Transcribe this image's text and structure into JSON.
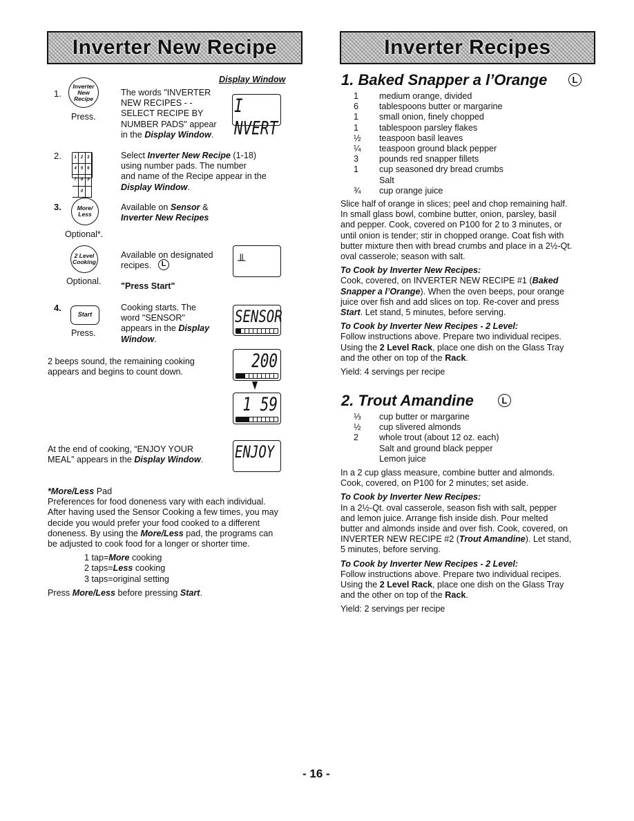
{
  "page_number": "- 16 -",
  "left": {
    "banner_title": "Inverter New Recipe",
    "display_window_heading": "Display Window",
    "steps": [
      {
        "number": "1.",
        "button_label_lines": [
          "Inverter",
          "New",
          "Recipe"
        ],
        "caption": "Press.",
        "text_lines": [
          "The words \"INVERTER",
          "NEW RECIPES - -",
          "SELECT RECIPE BY",
          "NUMBER PADS\" appear"
        ],
        "text_tail_prefix": "in the ",
        "text_tail_bold": "Display Window",
        "text_tail_suffix": ".",
        "display": "I NVERT"
      },
      {
        "number": "2.",
        "keypad_keys": [
          "1",
          "2",
          "3",
          "4",
          "5",
          "6",
          "7",
          "8",
          "9",
          "",
          "0",
          ""
        ],
        "text_prefix": "Select ",
        "text_bold": "Inverter New Recipe",
        "text_suffix": " (1-18)",
        "text_lines": [
          "using number pads. The number",
          "and name of the Recipe appear in the"
        ],
        "text_tail_bold": "Display Window",
        "text_tail_suffix": "."
      },
      {
        "number": "3.",
        "button_label_lines": [
          "More/",
          "Less"
        ],
        "caption": "Optional*.",
        "text_line1_prefix": "Available on ",
        "text_line1_bold": "Sensor",
        "text_line1_suffix": " &",
        "text_line2_bold": "Inverter New Recipes"
      },
      {
        "button_label_lines": [
          "2 Level",
          "Cooking"
        ],
        "caption": "Optional.",
        "text_line1": "Available on designated",
        "text_line2": "recipes.",
        "level_icon": "L",
        "press_start": "\"Press Start\"",
        "display": "╨"
      },
      {
        "number": "4.",
        "button_label": "Start",
        "caption": "Press.",
        "text_lines": [
          "Cooking starts. The",
          "word \"SENSOR\""
        ],
        "text_tail_prefix": "appears in the ",
        "text_tail_bold1": "Display",
        "text_tail_bold2": "Window",
        "text_tail_suffix": ".",
        "display": "SENSOR",
        "progress": 0.1
      }
    ],
    "countdown": {
      "text_lines": [
        "2 beeps sound, the remaining cooking",
        "appears and begins to count down."
      ],
      "display_start": "200",
      "display_start_progress": 0.2,
      "display_next": "1 59",
      "display_next_progress": 0.3
    },
    "end": {
      "text_line1": "At the end of cooking, “ENJOY YOUR",
      "text_line2_prefix": "MEAL” appears in the ",
      "text_line2_bold": "Display Window",
      "text_line2_suffix": ".",
      "display": "ENJOY"
    },
    "more_less_note": {
      "heading_bold": "*More/Less",
      "heading_suffix": " Pad",
      "lines": [
        "Preferences for food doneness vary with each individual.",
        "After having used the Sensor Cooking a few times, you may",
        "decide you would prefer your food cooked to a different"
      ],
      "line4_prefix": "doneness. By using the ",
      "line4_bold": "More/Less",
      "line4_suffix": " pad, the programs can",
      "line5": "be adjusted to cook food for a longer or shorter time.",
      "taps": [
        {
          "prefix": "1 tap=",
          "bold": "More",
          "suffix": " cooking"
        },
        {
          "prefix": "2 taps=",
          "bold": "Less",
          "suffix": " cooking"
        },
        {
          "prefix": "3 taps=original setting",
          "bold": "",
          "suffix": ""
        }
      ],
      "final_prefix": "Press ",
      "final_bold1": "More/Less",
      "final_mid": " before pressing ",
      "final_bold2": "Start",
      "final_suffix": "."
    }
  },
  "right": {
    "banner_title": "Inverter Recipes",
    "recipes": [
      {
        "title": "1. Baked Snapper a l’Orange",
        "level_icon": "L",
        "ingredients": [
          {
            "qty": "1",
            "text": "medium orange, divided"
          },
          {
            "qty": "6",
            "text": "tablespoons butter or margarine"
          },
          {
            "qty": "1",
            "text": "small onion, finely chopped"
          },
          {
            "qty": "1",
            "text": "tablespoon parsley flakes"
          },
          {
            "qty": "½",
            "text": "teaspoon basil leaves"
          },
          {
            "qty": "¼",
            "text": "teaspoon ground black pepper"
          },
          {
            "qty": "3",
            "text": "pounds red snapper fillets"
          },
          {
            "qty": "1",
            "text": "cup seasoned dry bread crumbs"
          },
          {
            "qty": "",
            "text": "Salt"
          },
          {
            "qty": "¾",
            "text": "cup orange juice"
          }
        ],
        "method_lines": [
          "Slice half of orange in slices; peel and chop remaining half.",
          "In small glass bowl, combine butter, onion, parsley, basil",
          "and pepper. Cook, covered on P100 for 2 to 3 minutes, or",
          "until onion is tender; stir in chopped orange. Coat fish with",
          "butter mixture then with bread crumbs and place in a 2½-Qt.",
          "oval casserole; season with salt."
        ],
        "cook_heading": "To Cook by Inverter New Recipes:",
        "cook_line1_prefix": "Cook, covered, on INVERTER NEW RECIPE #1 (",
        "cook_line1_bold": "Baked",
        "cook_line2_bold": "Snapper a l’Orange",
        "cook_line2_suffix": ").  When the oven beeps, pour orange",
        "cook_line3": "juice over fish and add slices on top.  Re-cover and press",
        "cook_line4_bold": "Start",
        "cook_line4_suffix": ".  Let stand, 5 minutes, before serving.",
        "level_heading": "To Cook by Inverter New Recipes - 2 Level:",
        "level_line1": "Follow instructions above. Prepare two individual recipes.",
        "level_line2_prefix": "Using the ",
        "level_line2_bold": "2 Level Rack",
        "level_line2_suffix": ", place one dish on the Glass Tray",
        "level_line3_prefix": "and the other on top of the ",
        "level_line3_bold": "Rack",
        "level_line3_suffix": ".",
        "yield": "Yield: 4 servings per recipe"
      },
      {
        "title": "2. Trout Amandine",
        "level_icon": "L",
        "ingredients": [
          {
            "qty": "⅓",
            "text": "cup butter or margarine"
          },
          {
            "qty": "½",
            "text": "cup slivered almonds"
          },
          {
            "qty": "2",
            "text": "whole trout (about 12 oz. each)"
          },
          {
            "qty": "",
            "text": "Salt and ground black pepper"
          },
          {
            "qty": "",
            "text": "Lemon juice"
          }
        ],
        "method_lines": [
          "In a 2 cup glass measure, combine butter and almonds.",
          "Cook, covered, on P100 for 2 minutes; set aside."
        ],
        "cook_heading": "To Cook by Inverter New Recipes:",
        "cook_lines": [
          "In a 2½-Qt. oval casserole, season fish with salt, pepper",
          "and lemon juice.  Arrange fish inside dish.  Pour melted",
          "butter and almonds inside and over fish. Cook, covered, on"
        ],
        "cook_line4_prefix": "INVERTER NEW RECIPE #2 (",
        "cook_line4_bold": "Trout Amandine",
        "cook_line4_suffix": "). Let stand,",
        "cook_line5": "5 minutes, before serving.",
        "level_heading": "To Cook by Inverter New Recipes - 2 Level:",
        "level_line1": "Follow instructions above. Prepare two individual recipes.",
        "level_line2_prefix": "Using the ",
        "level_line2_bold": "2 Level Rack",
        "level_line2_suffix": ", place one dish on the Glass Tray",
        "level_line3_prefix": "and the other on top of the ",
        "level_line3_bold": "Rack",
        "level_line3_suffix": ".",
        "yield": "Yield: 2 servings per recipe"
      }
    ]
  }
}
